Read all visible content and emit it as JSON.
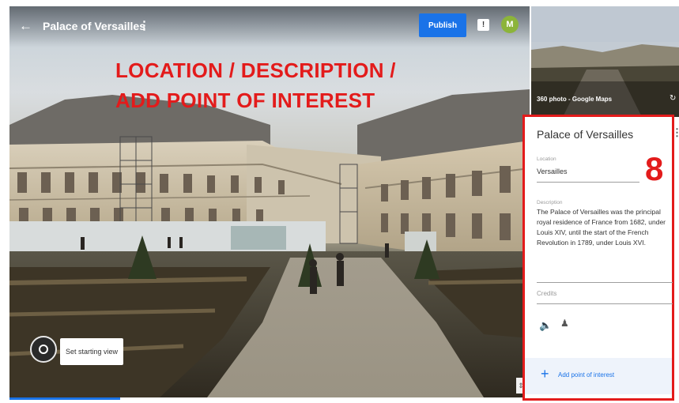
{
  "header": {
    "back_icon": "arrow-left-icon",
    "title": "Palace of Versailles",
    "title_menu_icon": "more-vert-icon",
    "publish_label": "Publish",
    "feedback_icon": "feedback-icon",
    "avatar_initial": "M",
    "avatar_color": "#8cb43a",
    "publish_color": "#1a73e8"
  },
  "overlay": {
    "line1": "LOCATION / DESCRIPTION /",
    "line2": "ADD POINT OF INTEREST",
    "color": "#e31b1b"
  },
  "viewer": {
    "set_start_label": "Set starting view",
    "compass_icon": "compass-icon",
    "fullscreen_icon": "fullscreen-icon"
  },
  "thumbnail": {
    "label": "360 photo - Google Maps",
    "link_icon": "link-icon"
  },
  "panel": {
    "title": "Palace of Versailles",
    "menu_icon": "more-vert-icon",
    "location_label": "Location",
    "location_value": "Versailles",
    "description_label": "Description",
    "description_text": "The Palace of Versailles was the principal royal residence of France from 1682, under Louis XIV, until the start of the French Revolution in 1789, under Louis XVI.",
    "credits_label": "Credits",
    "audio_icon": "volume-icon",
    "person_icon": "person-add-icon",
    "add_poi_label": "Add point of interest",
    "add_icon": "plus-icon",
    "marker_number": "8",
    "highlight_color": "#e31b1b"
  }
}
